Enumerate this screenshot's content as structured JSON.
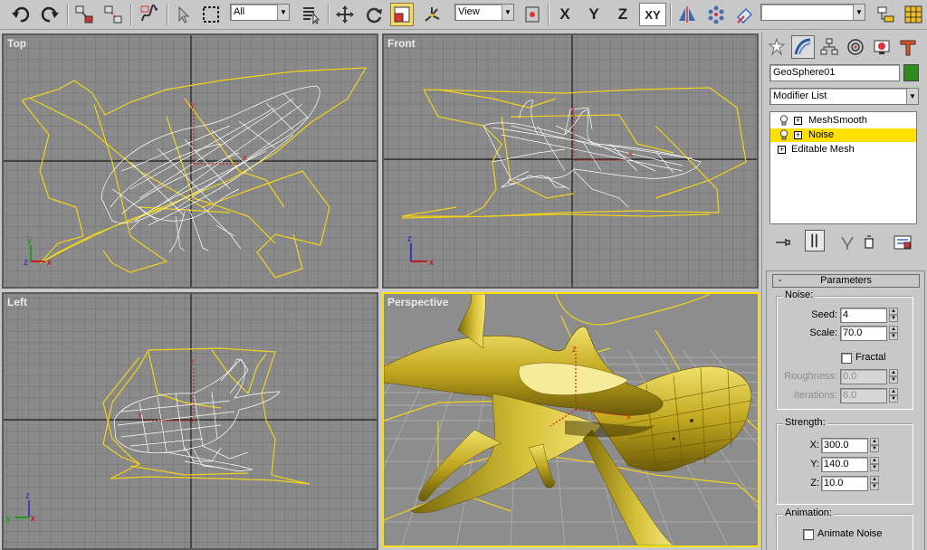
{
  "toolbar": {
    "selection_filter": "All",
    "ref_coord": "View",
    "axis_x": "X",
    "axis_y": "Y",
    "axis_z": "Z",
    "axis_xy": "XY",
    "named_selection": "",
    "icons": [
      "undo-icon",
      "redo-icon",
      "link-icon",
      "unlink-icon",
      "bind-spacewarp-icon",
      "select-icon",
      "region-select-icon",
      "select-by-name-icon",
      "move-icon",
      "rotate-icon",
      "scale-icon",
      "manipulate-icon",
      "pivot-icon",
      "mirror-icon",
      "array-icon",
      "align-icon",
      "layers-icon",
      "curve-editor-icon"
    ]
  },
  "viewports": {
    "top": "Top",
    "front": "Front",
    "left": "Left",
    "perspective": "Perspective",
    "axis_labels": {
      "x": "x",
      "y": "y",
      "z": "z"
    },
    "colors": {
      "wire": "#ffffff",
      "gizmo": "#f2d21c",
      "active_border": "#ffe000",
      "grid_bg": "#8a8a8a"
    }
  },
  "panel": {
    "tabs": [
      "create-icon",
      "modify-icon",
      "hierarchy-icon",
      "motion-icon",
      "display-icon",
      "utilities-icon"
    ],
    "object_name": "GeoSphere01",
    "object_color": "#2e8b1e",
    "modifier_list": "Modifier List",
    "stack": [
      {
        "label": "MeshSmooth",
        "selected": false
      },
      {
        "label": "Noise",
        "selected": true
      },
      {
        "label": "Editable Mesh",
        "selected": false
      }
    ],
    "stack_tools": [
      "pin-stack-icon",
      "show-end-result-icon",
      "make-unique-icon",
      "remove-modifier-icon",
      "configure-sets-icon"
    ],
    "parameters": {
      "title": "Parameters",
      "collapse": "-",
      "noise_label": "Noise:",
      "seed_label": "Seed:",
      "seed": "4",
      "scale_label": "Scale:",
      "scale": "70.0",
      "fractal_label": "Fractal",
      "roughness_label": "Roughness:",
      "roughness": "0.0",
      "iterations_label": "Iterations:",
      "iterations": "6.0",
      "strength_label": "Strength:",
      "x_label": "X:",
      "x": "300.0",
      "y_label": "Y:",
      "y": "140.0",
      "z_label": "Z:",
      "z": "10.0",
      "animation_label": "Animation:",
      "animate_noise_label": "Animate Noise"
    }
  }
}
